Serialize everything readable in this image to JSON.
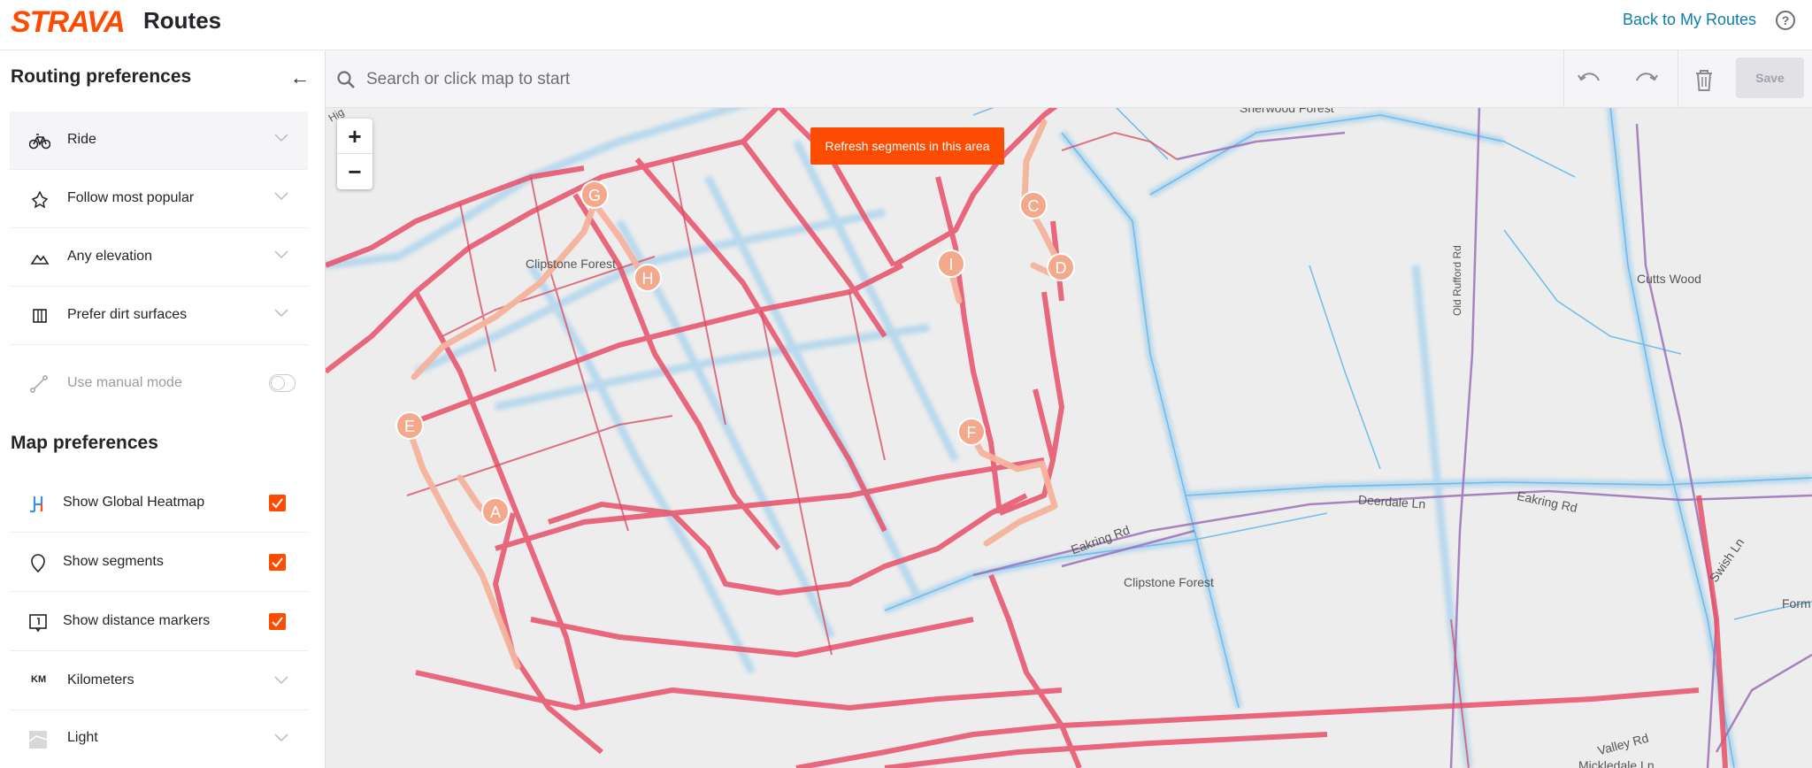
{
  "header": {
    "logo": "STRAVA",
    "title": "Routes",
    "back_link": "Back to My Routes",
    "help": "?"
  },
  "sidebar": {
    "routing_heading": "Routing preferences",
    "collapse": "←",
    "routing_items": [
      {
        "label": "Ride",
        "icon": "bike-icon"
      },
      {
        "label": "Follow most popular",
        "icon": "popular-icon"
      },
      {
        "label": "Any elevation",
        "icon": "elevation-icon"
      },
      {
        "label": "Prefer dirt surfaces",
        "icon": "surface-icon"
      }
    ],
    "manual_mode": {
      "label": "Use manual mode",
      "enabled": false
    },
    "map_heading": "Map preferences",
    "map_items": [
      {
        "label": "Show Global Heatmap",
        "checked": true,
        "icon": "heatmap-icon"
      },
      {
        "label": "Show segments",
        "checked": true,
        "icon": "segment-icon"
      },
      {
        "label": "Show distance markers",
        "checked": true,
        "icon": "distance-marker-icon"
      },
      {
        "label": "Kilometers",
        "icon": "km-icon",
        "icon_text": "KM"
      },
      {
        "label": "Light",
        "icon": "map-style-icon"
      }
    ]
  },
  "search": {
    "placeholder": "Search or click map to start"
  },
  "toolbar": {
    "save_label": "Save"
  },
  "map": {
    "zoom_in": "+",
    "zoom_out": "−",
    "refresh_label": "Refresh segments in this area",
    "place_labels": [
      "Sherwood Forest",
      "Clipstone Forest",
      "Cutts Wood",
      "Old Rufford Rd",
      "Deerdale Ln",
      "Eakring Rd",
      "Eakring Rd",
      "Clipstone Forest",
      "Swish Ln",
      "Form",
      "Valley Rd",
      "Mickledale Ln",
      "Hig"
    ],
    "waypoints": [
      "A",
      "C",
      "D",
      "E",
      "F",
      "G",
      "H",
      "I"
    ]
  },
  "colors": {
    "brand": "#fc4c02",
    "link": "#0a7fa8",
    "heat_red": "#e8506a",
    "heat_blue": "#6ab8e8",
    "waypoint": "#f5a98c"
  }
}
